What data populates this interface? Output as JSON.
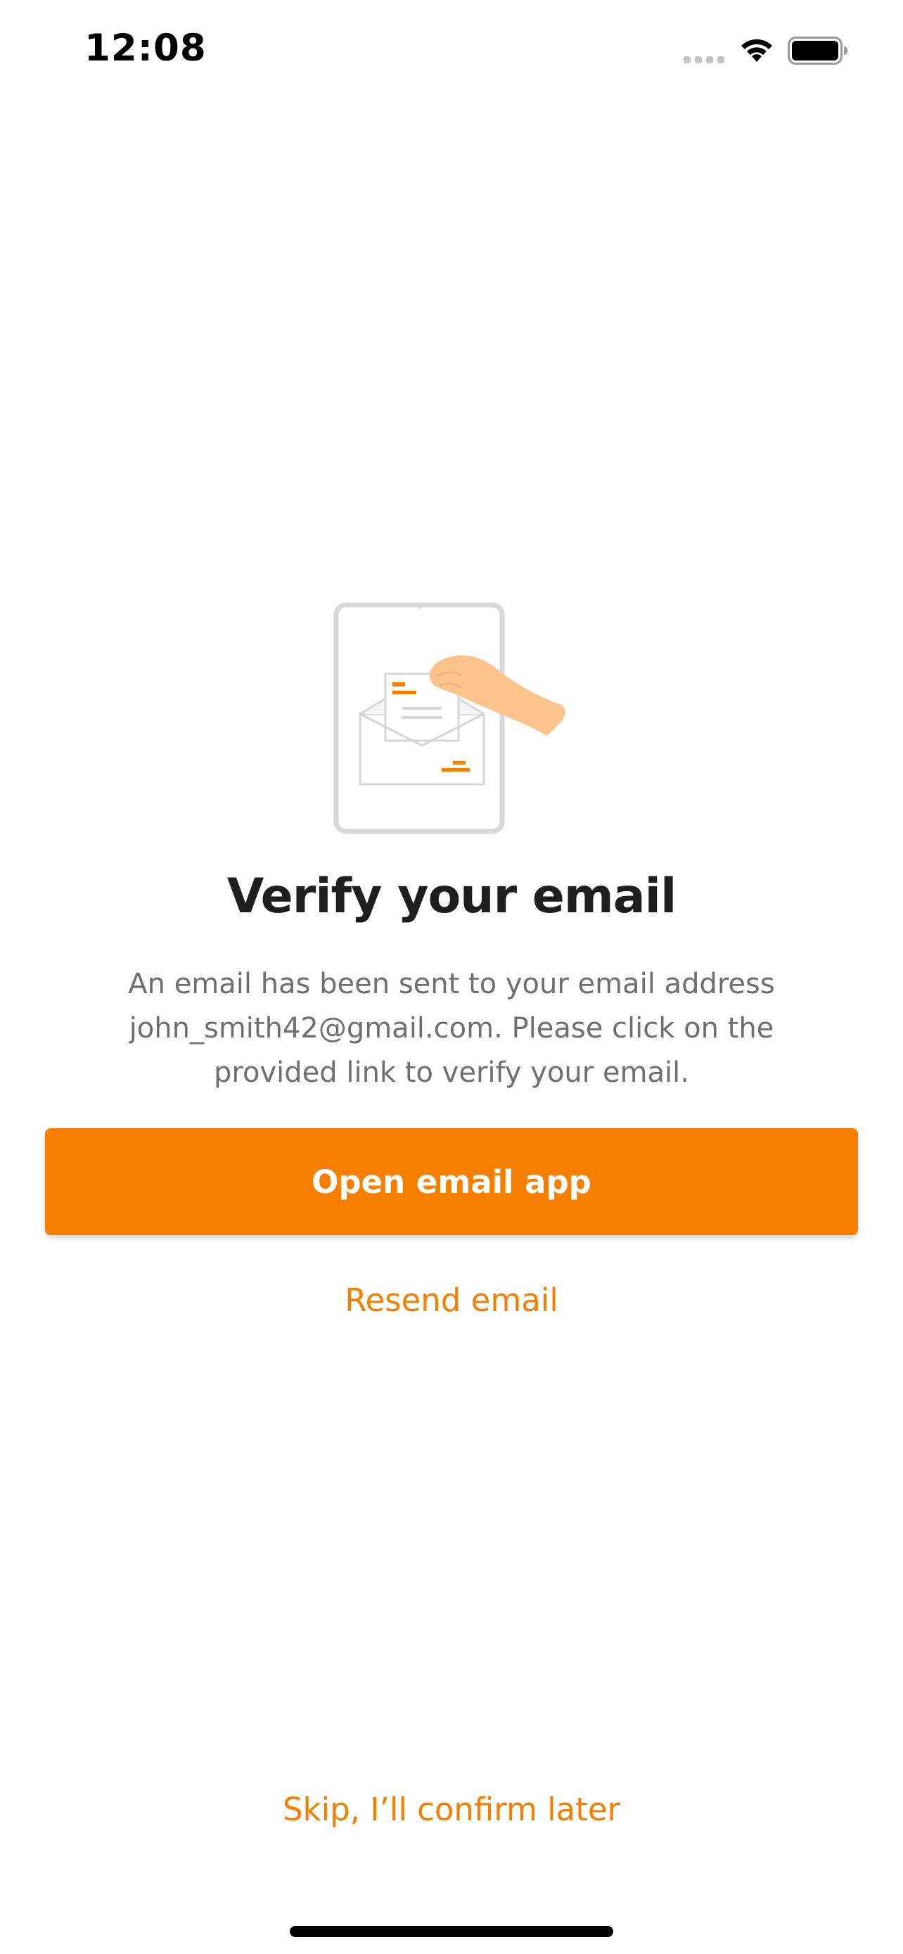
{
  "status_bar": {
    "time": "12:08"
  },
  "icons": {
    "signal": "cellular-signal-icon",
    "wifi": "wifi-icon",
    "battery": "battery-icon",
    "illustration": "email-envelope-illustration"
  },
  "colors": {
    "accent": "#f77f00",
    "title": "#1e1e1e",
    "body_text": "#6f6f6f",
    "background": "#ffffff"
  },
  "content": {
    "title": "Verify your email",
    "description": "An email has been sent to your email address john_smith42@gmail.com. Please click on the provided link to verify your email.",
    "primary_button": "Open email app",
    "resend_link": "Resend email",
    "skip_link": "Skip, I’ll confirm later"
  }
}
